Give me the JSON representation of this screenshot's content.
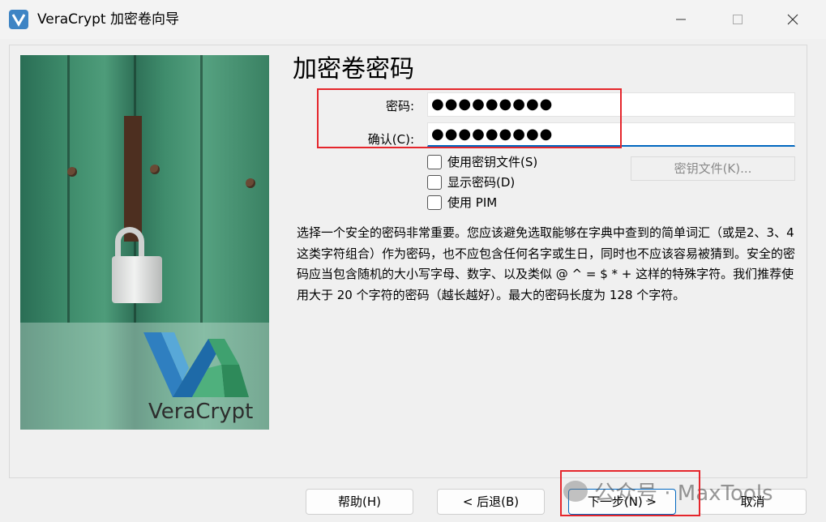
{
  "window": {
    "title": "VeraCrypt 加密卷向导",
    "icon": "veracrypt-app-icon",
    "controls": [
      "minimize-icon",
      "maximize-icon",
      "close-icon"
    ]
  },
  "sidebar": {
    "image": "veracrypt-padlock-artwork",
    "brand_text": "VeraCrypt"
  },
  "page": {
    "heading": "加密卷密码",
    "password_label": "密码:",
    "password_value": "●●●●●●●●●",
    "confirm_label": "确认(C):",
    "confirm_value": "●●●●●●●●●",
    "checkboxes": [
      {
        "label": "使用密钥文件(S)",
        "checked": false
      },
      {
        "label": "显示密码(D)",
        "checked": false
      },
      {
        "label": "使用 PIM",
        "checked": false
      }
    ],
    "keyfiles_button": "密钥文件(K)...",
    "description": "选择一个安全的密码非常重要。您应该避免选取能够在字典中查到的简单词汇（或是2、3、4 这类字符组合）作为密码，也不应包含任何名字或生日，同时也不应该容易被猜到。安全的密码应当包含随机的大小写字母、数字、以及类似 @ ^ = $ * + 这样的特殊字符。我们推荐使用大于 20 个字符的密码（越长越好）。最大的密码长度为 128 个字符。"
  },
  "buttons": {
    "help": "帮助(H)",
    "back": "< 后退(B)",
    "next": "下一步(N) >",
    "cancel": "取消"
  },
  "watermark": "公众号 · MaxTools",
  "colors": {
    "annotation": "#e5262c",
    "focus": "#0067c0"
  }
}
